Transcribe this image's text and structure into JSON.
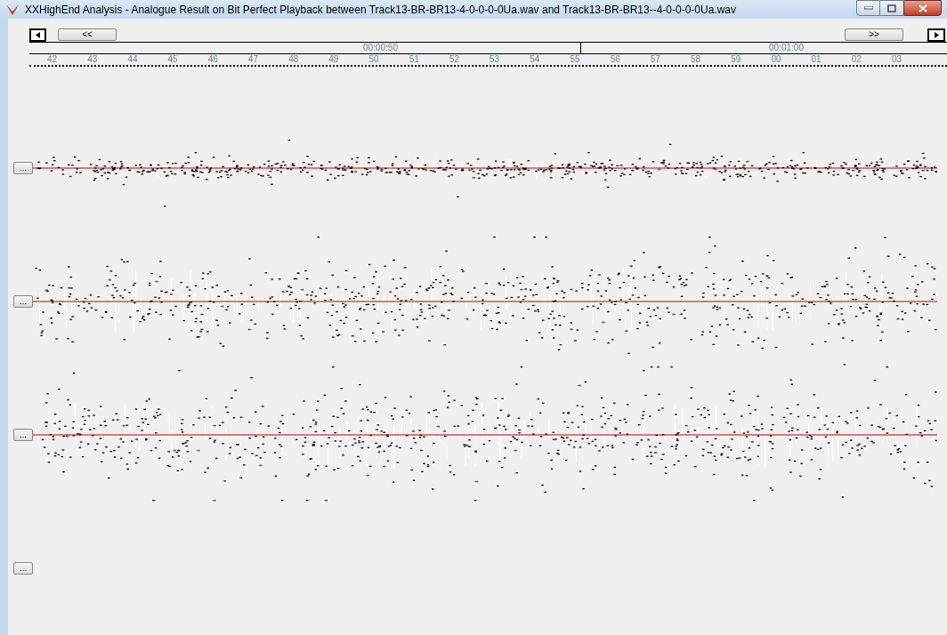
{
  "window": {
    "title": "XXHighEnd Analysis - Analogue Result on Bit Perfect Playback between Track13-BR-BR13-4-0-0-0-0Ua.wav and Track13-BR-BR13--4-0-0-0-0Ua.wav"
  },
  "navigation": {
    "back_label": "<<",
    "forward_label": ">>"
  },
  "timeline": {
    "time_labels": [
      "00:00:50",
      "00:01:00"
    ],
    "seconds": [
      "42",
      "43",
      "44",
      "45",
      "46",
      "47",
      "48",
      "49",
      "50",
      "51",
      "52",
      "53",
      "54",
      "55",
      "56",
      "57",
      "58",
      "59",
      "00",
      "01",
      "02",
      "03"
    ]
  },
  "channels": [
    {
      "kind": "narrow",
      "button": "..."
    },
    {
      "kind": "wide",
      "button": "..."
    },
    {
      "kind": "wide",
      "button": "..."
    },
    {
      "kind": "empty",
      "button": "..."
    }
  ]
}
